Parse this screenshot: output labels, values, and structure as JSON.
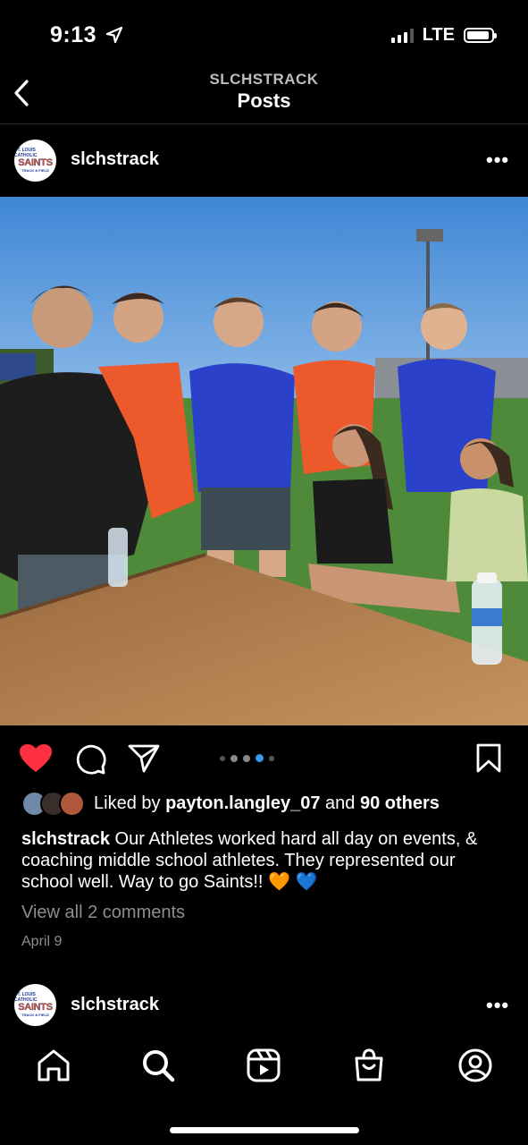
{
  "status_bar": {
    "time": "9:13",
    "network": "LTE"
  },
  "header": {
    "account": "SLCHSTRACK",
    "title": "Posts"
  },
  "post": {
    "username": "slchstrack",
    "avatar_text": {
      "line1": "ST. LOUIS CATHOLIC",
      "line2": "SAINTS",
      "line3": "TRACK & FIELD"
    },
    "carousel": {
      "count": 5,
      "active_index": 3
    },
    "liked": true,
    "likes": {
      "prefix": "Liked by ",
      "user": "payton.langley_07",
      "middle": " and ",
      "others": "90 others"
    },
    "caption": {
      "username": "slchstrack",
      "text": " Our Athletes worked hard all day on events, & coaching middle school athletes.  They represented our school well.  Way to go Saints!! 🧡 💙"
    },
    "comments_link": "View all 2 comments",
    "date": "April 9"
  },
  "next_post": {
    "username": "slchstrack"
  },
  "nav": {
    "items": [
      "home",
      "search",
      "reels",
      "shop",
      "profile"
    ]
  },
  "colors": {
    "like_red": "#ff3040",
    "carousel_active": "#3897f0",
    "sky": "#4a8fd8",
    "grass": "#4f8a3a",
    "table": "#b07a48"
  }
}
